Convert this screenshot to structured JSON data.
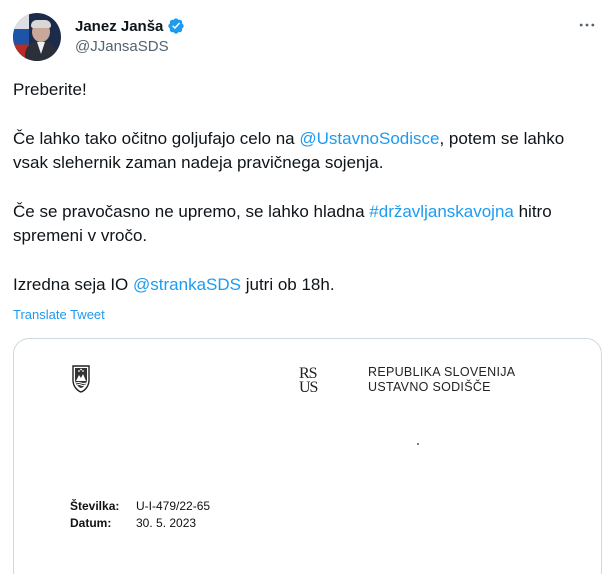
{
  "author": {
    "display_name": "Janez Janša",
    "handle": "@JJansaSDS",
    "verified": true
  },
  "tweet": {
    "p1": "Preberite!",
    "p2_a": "Če lahko tako očitno goljufajo celo na ",
    "p2_link": "@UstavnoSodisce",
    "p2_b": ", potem se lahko vsak slehernik zaman nadeja pravičnega sojenja.",
    "p3_a": "Če se pravočasno ne upremo, se lahko hladna ",
    "p3_link": "#državljanskavojna",
    "p3_b": " hitro spremeni v vročo.",
    "p4_a": "Izredna seja IO ",
    "p4_link": "@strankaSDS",
    "p4_b": " jutri ob 18h."
  },
  "actions": {
    "translate_label": "Translate Tweet"
  },
  "document": {
    "logo_top": "RS",
    "logo_bottom": "US",
    "court_line1": "REPUBLIKA SLOVENIJA",
    "court_line2": "USTAVNO SODIŠČE",
    "number_label": "Številka:",
    "number_value": "U-I-479/22-65",
    "date_label": "Datum:",
    "date_value": "30. 5. 2023"
  },
  "colors": {
    "link": "#1d9bf0",
    "secondary_text": "#536471",
    "border": "#cfd9de"
  },
  "icons": {
    "verified": "verified-badge-icon",
    "more": "more-options-icon",
    "coat_of_arms": "coat-of-arms-icon"
  }
}
